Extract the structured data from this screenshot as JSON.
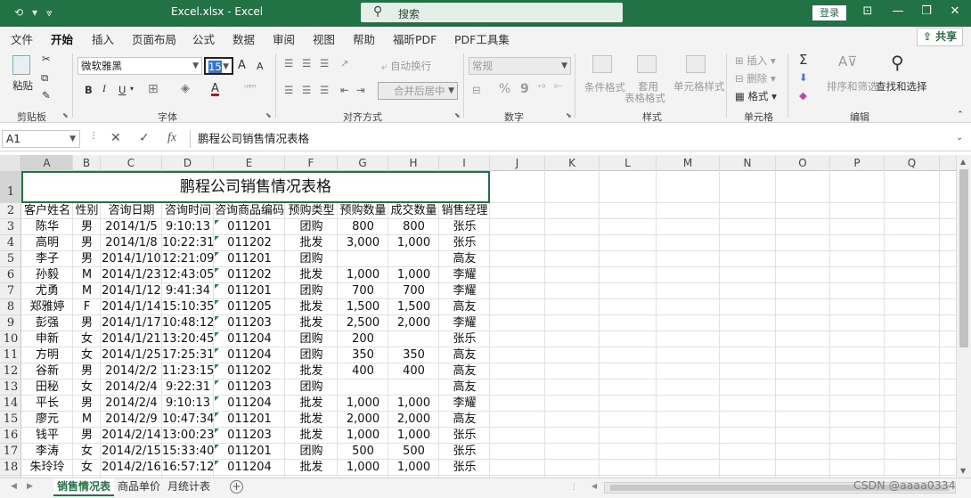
{
  "window": {
    "title": "Excel.xlsx  -  Excel",
    "search_label": "搜索",
    "login_label": "登录",
    "share_label": "共享",
    "quick_access": [
      "autosave-icon",
      "undo-icon",
      "customize-icon"
    ]
  },
  "tabs": [
    "文件",
    "开始",
    "插入",
    "页面布局",
    "公式",
    "数据",
    "审阅",
    "视图",
    "帮助",
    "福昕PDF",
    "PDF工具集"
  ],
  "active_tab": "开始",
  "ribbon": {
    "groups": {
      "clipboard": "剪贴板",
      "font": "字体",
      "align": "对齐方式",
      "number": "数字",
      "styles": "样式",
      "cells": "单元格",
      "editing": "编辑"
    },
    "paste_label": "粘贴",
    "font_name": "微软雅黑",
    "font_size": "15",
    "bold": "B",
    "italic": "I",
    "underline": "U",
    "grow_font": "A",
    "shrink_font": "A",
    "font_color_glyph": "A",
    "wrap_text": "自动换行",
    "merge_center": "合并后居中",
    "number_format": "常规",
    "percent": "%",
    "comma": "9",
    "conditional_format": "条件格式",
    "table_format_1": "套用",
    "table_format_2": "表格格式",
    "cell_styles": "单元格样式",
    "insert": "插入",
    "delete": "删除",
    "format": "格式",
    "sum_glyph": "Σ",
    "sort_filter": "排序和筛选",
    "find_select": "查找和选择"
  },
  "formula_bar": {
    "name_box": "A1",
    "cancel_glyph": "✕",
    "enter_glyph": "✓",
    "fx_glyph": "fx",
    "content": "鹏程公司销售情况表格"
  },
  "grid": {
    "columns": [
      "A",
      "B",
      "C",
      "D",
      "E",
      "F",
      "G",
      "H",
      "I",
      "J",
      "K",
      "L",
      "M",
      "N",
      "O",
      "P",
      "Q"
    ],
    "row_numbers": [
      "1",
      "2",
      "3",
      "4",
      "5",
      "6",
      "7",
      "8",
      "9",
      "10",
      "11",
      "12",
      "13",
      "14",
      "15",
      "16",
      "17",
      "18"
    ],
    "title": "鹏程公司销售情况表格",
    "headers": [
      "客户姓名",
      "性别",
      "咨询日期",
      "咨询时间",
      "咨询商品编码",
      "预购类型",
      "预购数量",
      "成交数量",
      "销售经理"
    ],
    "rows": [
      [
        "陈华",
        "男",
        "2014/1/5",
        "9:10:13",
        "011201",
        "团购",
        "800",
        "800",
        "张乐"
      ],
      [
        "高明",
        "男",
        "2014/1/8",
        "10:22:31",
        "011202",
        "批发",
        "3,000",
        "1,000",
        "张乐"
      ],
      [
        "李子",
        "男",
        "2014/1/10",
        "12:21:09",
        "011201",
        "团购",
        "",
        "",
        "高友"
      ],
      [
        "孙毅",
        "M",
        "2014/1/23",
        "12:43:05",
        "011202",
        "批发",
        "1,000",
        "1,000",
        "李耀"
      ],
      [
        "尤勇",
        "M",
        "2014/1/12",
        "9:41:34",
        "011201",
        "团购",
        "700",
        "700",
        "李耀"
      ],
      [
        "郑雅婷",
        "F",
        "2014/1/14",
        "15:10:35",
        "011205",
        "批发",
        "1,500",
        "1,500",
        "高友"
      ],
      [
        "彭强",
        "男",
        "2014/1/17",
        "10:48:12",
        "011203",
        "批发",
        "2,500",
        "2,000",
        "李耀"
      ],
      [
        "申新",
        "女",
        "2014/1/21",
        "13:20:45",
        "011204",
        "团购",
        "200",
        "",
        "张乐"
      ],
      [
        "方明",
        "女",
        "2014/1/25",
        "17:25:31",
        "011204",
        "团购",
        "350",
        "350",
        "高友"
      ],
      [
        "谷新",
        "男",
        "2014/2/2",
        "11:23:15",
        "011202",
        "批发",
        "400",
        "400",
        "高友"
      ],
      [
        "田秘",
        "女",
        "2014/2/4",
        "9:22:31",
        "011203",
        "团购",
        "",
        "",
        "高友"
      ],
      [
        "平长",
        "男",
        "2014/2/4",
        "9:10:13",
        "011204",
        "批发",
        "1,000",
        "1,000",
        "李耀"
      ],
      [
        "廖元",
        "M",
        "2014/2/9",
        "10:47:34",
        "011201",
        "批发",
        "2,000",
        "2,000",
        "高友"
      ],
      [
        "钱平",
        "男",
        "2014/2/14",
        "13:00:23",
        "011203",
        "批发",
        "1,000",
        "1,000",
        "张乐"
      ],
      [
        "李涛",
        "女",
        "2014/2/15",
        "15:33:40",
        "011201",
        "团购",
        "500",
        "500",
        "张乐"
      ],
      [
        "朱玲玲",
        "女",
        "2014/2/16",
        "16:57:12",
        "011204",
        "批发",
        "1,000",
        "1,000",
        "张乐"
      ]
    ]
  },
  "sheets": [
    "销售情况表",
    "商品单价",
    "月统计表"
  ],
  "active_sheet": "销售情况表",
  "add_sheet_glyph": "+",
  "watermark": "CSDN @aaaa0334",
  "colors": {
    "accent": "#217346",
    "error_marker": "#1e8c3a"
  }
}
